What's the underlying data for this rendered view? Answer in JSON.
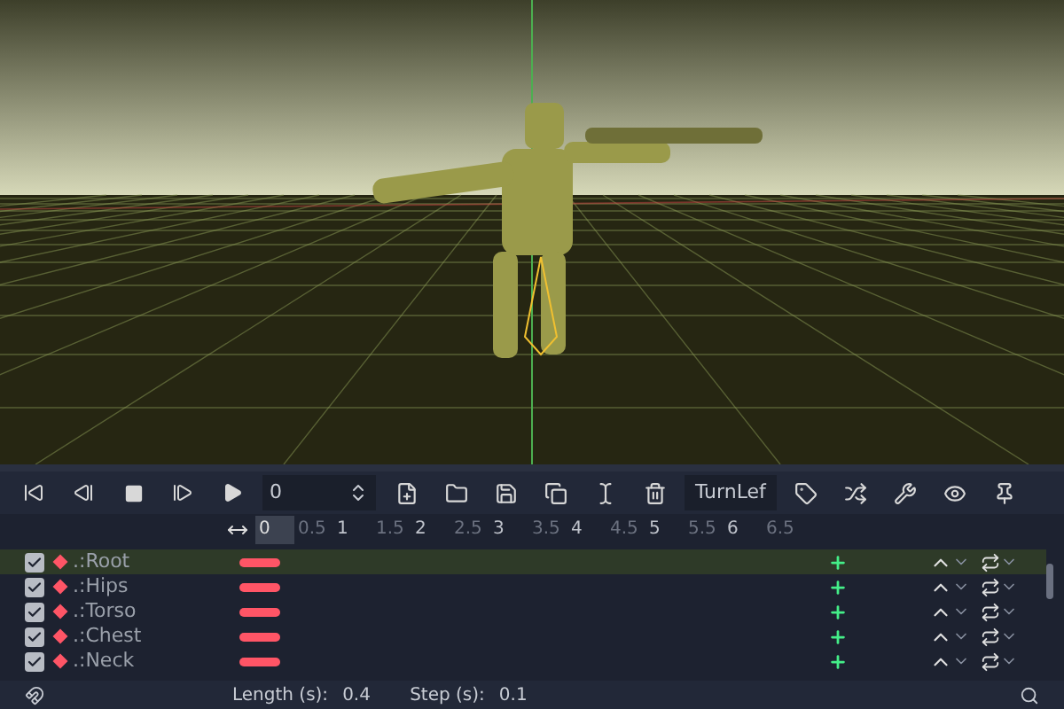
{
  "toolbar": {
    "frame": "0",
    "animation": "TurnLef"
  },
  "timeline": {
    "ticks": [
      {
        "label": "0",
        "selected": true
      },
      {
        "label": "0.5",
        "selected": false
      },
      {
        "label": "1",
        "selected": false
      },
      {
        "label": "1.5",
        "selected": false
      },
      {
        "label": "2",
        "selected": false
      },
      {
        "label": "2.5",
        "selected": false
      },
      {
        "label": "3",
        "selected": false
      },
      {
        "label": "3.5",
        "selected": false
      },
      {
        "label": "4",
        "selected": false
      },
      {
        "label": "4.5",
        "selected": false
      },
      {
        "label": "5",
        "selected": false
      },
      {
        "label": "5.5",
        "selected": false
      },
      {
        "label": "6",
        "selected": false
      },
      {
        "label": "6.5",
        "selected": false
      }
    ]
  },
  "tracks": [
    {
      "name": ".:Root",
      "enabled": true,
      "selected": true
    },
    {
      "name": ".:Hips",
      "enabled": true,
      "selected": false
    },
    {
      "name": ".:Torso",
      "enabled": true,
      "selected": false
    },
    {
      "name": ".:Chest",
      "enabled": true,
      "selected": false
    },
    {
      "name": ".:Neck",
      "enabled": true,
      "selected": false
    }
  ],
  "footer": {
    "length_label": "Length (s):",
    "length": "0.4",
    "step_label": "Step (s):",
    "step": "0.1"
  }
}
